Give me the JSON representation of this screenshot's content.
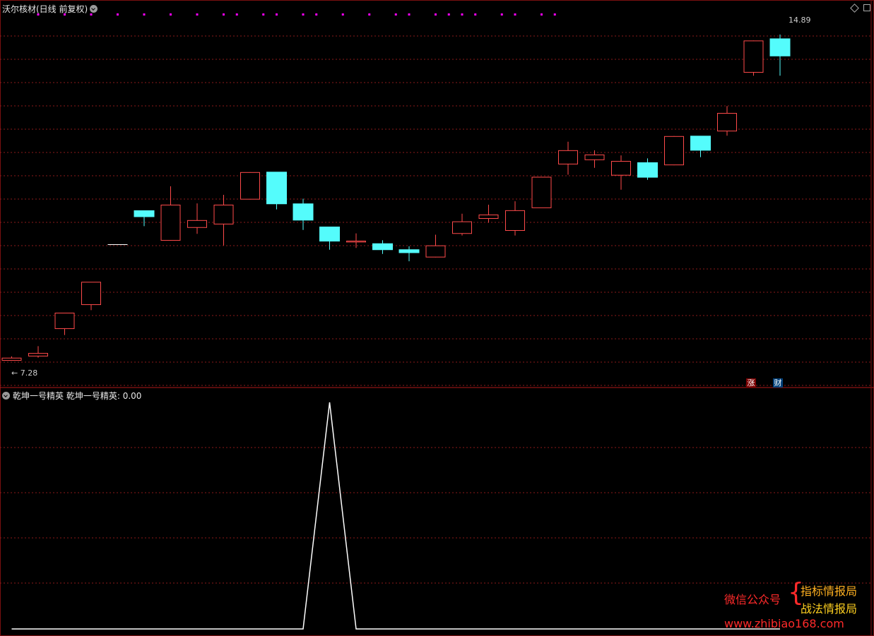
{
  "header": {
    "title": "沃尔核材(日线 前复权)"
  },
  "indicator_header": {
    "name": "乾坤一号精英",
    "label": "乾坤一号精英: 0.00"
  },
  "price_labels": {
    "high": "14.89",
    "low": "7.28"
  },
  "badges": {
    "zhang": "涨",
    "cai": "财"
  },
  "watermark": {
    "prefix": "微信公众号",
    "line1": "指标情报局",
    "line2": "战法情报局",
    "url": "www.zhibiao168.com"
  },
  "colors": {
    "up": "#ff4a4a",
    "down": "#54fcfc",
    "grid": "#8b1a1a",
    "marker": "#ff00ff",
    "indicator": "#ffffff"
  },
  "chart_data": [
    {
      "type": "candlestick",
      "ylim": [
        7.0,
        15.3
      ],
      "marker_positions": [
        2,
        4,
        6,
        8,
        10,
        12,
        14,
        16,
        17,
        19,
        20,
        22,
        23,
        25,
        27,
        29,
        30,
        32,
        33,
        34,
        35,
        37,
        38,
        40,
        41
      ],
      "candles": [
        {
          "o": 7.35,
          "h": 7.38,
          "l": 7.28,
          "c": 7.28,
          "dir": "up"
        },
        {
          "o": 7.38,
          "h": 7.62,
          "l": 7.35,
          "c": 7.46,
          "dir": "up"
        },
        {
          "o": 8.02,
          "h": 8.12,
          "l": 7.88,
          "c": 8.4,
          "dir": "up"
        },
        {
          "o": 8.58,
          "h": 8.58,
          "l": 8.46,
          "c": 9.12,
          "dir": "up"
        },
        {
          "o": 9.99,
          "h": 9.99,
          "l": 9.99,
          "c": 9.99,
          "dir": "flat"
        },
        {
          "o": 10.78,
          "h": 10.78,
          "l": 10.42,
          "c": 10.64,
          "dir": "down"
        },
        {
          "o": 10.08,
          "h": 11.35,
          "l": 10.08,
          "c": 10.92,
          "dir": "up"
        },
        {
          "o": 10.38,
          "h": 10.95,
          "l": 10.24,
          "c": 10.56,
          "dir": "up"
        },
        {
          "o": 10.46,
          "h": 11.15,
          "l": 9.97,
          "c": 10.92,
          "dir": "up"
        },
        {
          "o": 11.04,
          "h": 11.68,
          "l": 11.04,
          "c": 11.68,
          "dir": "up"
        },
        {
          "o": 11.68,
          "h": 11.68,
          "l": 10.81,
          "c": 10.94,
          "dir": "down"
        },
        {
          "o": 10.94,
          "h": 11.06,
          "l": 10.33,
          "c": 10.56,
          "dir": "down"
        },
        {
          "o": 10.4,
          "h": 10.4,
          "l": 9.87,
          "c": 10.07,
          "dir": "down"
        },
        {
          "o": 10.04,
          "h": 10.25,
          "l": 9.91,
          "c": 10.08,
          "dir": "up"
        },
        {
          "o": 10.01,
          "h": 10.09,
          "l": 9.77,
          "c": 9.87,
          "dir": "down"
        },
        {
          "o": 9.87,
          "h": 9.95,
          "l": 9.6,
          "c": 9.8,
          "dir": "down"
        },
        {
          "o": 9.69,
          "h": 10.22,
          "l": 9.69,
          "c": 9.97,
          "dir": "up"
        },
        {
          "o": 10.24,
          "h": 10.71,
          "l": 10.2,
          "c": 10.53,
          "dir": "up"
        },
        {
          "o": 10.59,
          "h": 10.92,
          "l": 10.5,
          "c": 10.69,
          "dir": "up"
        },
        {
          "o": 10.31,
          "h": 11.0,
          "l": 10.2,
          "c": 10.79,
          "dir": "up"
        },
        {
          "o": 10.84,
          "h": 10.84,
          "l": 10.84,
          "c": 11.57,
          "dir": "up"
        },
        {
          "o": 11.86,
          "h": 12.39,
          "l": 11.62,
          "c": 12.19,
          "dir": "up"
        },
        {
          "o": 11.96,
          "h": 12.19,
          "l": 11.78,
          "c": 12.09,
          "dir": "up"
        },
        {
          "o": 11.6,
          "h": 12.07,
          "l": 11.27,
          "c": 11.94,
          "dir": "up"
        },
        {
          "o": 11.9,
          "h": 12.0,
          "l": 11.5,
          "c": 11.56,
          "dir": "down"
        },
        {
          "o": 11.84,
          "h": 12.52,
          "l": 11.84,
          "c": 12.52,
          "dir": "up"
        },
        {
          "o": 12.52,
          "h": 12.52,
          "l": 12.03,
          "c": 12.19,
          "dir": "down"
        },
        {
          "o": 12.63,
          "h": 13.22,
          "l": 12.53,
          "c": 13.06,
          "dir": "up"
        },
        {
          "o": 14.0,
          "h": 14.75,
          "l": 13.93,
          "c": 14.75,
          "dir": "up"
        },
        {
          "o": 14.79,
          "h": 14.89,
          "l": 13.93,
          "c": 14.39,
          "dir": "down"
        }
      ]
    },
    {
      "type": "line",
      "ylim": [
        0,
        1
      ],
      "values": [
        0,
        0,
        0,
        0,
        0,
        0,
        0,
        0,
        0,
        0,
        0,
        0,
        1,
        0,
        0,
        0,
        0,
        0,
        0,
        0,
        0,
        0,
        0,
        0,
        0,
        0,
        0,
        0,
        0,
        0
      ]
    }
  ]
}
